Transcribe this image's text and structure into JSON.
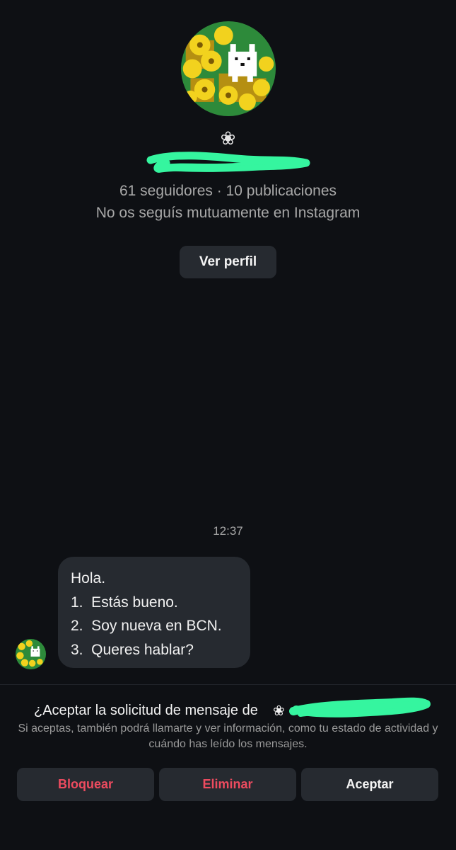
{
  "profile": {
    "display_glyph": "❀",
    "stats": "61 seguidores · 10 publicaciones",
    "mutual_note": "No os seguís mutuamente en Instagram",
    "view_profile_label": "Ver perfil"
  },
  "conversation": {
    "timestamp": "12:37",
    "message_lines": [
      "Hola.",
      "1.  Estás bueno.",
      "2.  Soy nueva en BCN.",
      "3.  Queres hablar?"
    ]
  },
  "request": {
    "title_prefix": "¿Aceptar la solicitud de mensaje de",
    "title_glyph": "❀",
    "description": "Si aceptas, también podrá llamarte y ver información, como tu estado de actividad y cuándo has leído los mensajes.",
    "actions": {
      "block_label": "Bloquear",
      "delete_label": "Eliminar",
      "accept_label": "Aceptar"
    }
  },
  "colors": {
    "background": "#0e1014",
    "surface": "#262a30",
    "destructive": "#ed4b5f",
    "secondary_text": "#a8a8a8",
    "redaction_marker": "#35f59f"
  },
  "icons": {
    "avatar": "yellow-flowers-with-white-dog-avatar",
    "redaction": "green-marker-scribble"
  }
}
